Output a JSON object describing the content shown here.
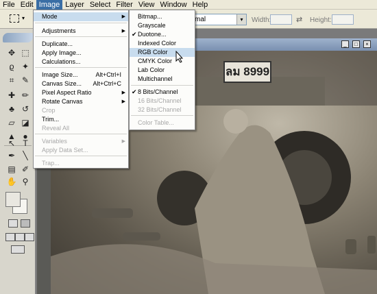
{
  "menubar": {
    "items": [
      "File",
      "Edit",
      "Image",
      "Layer",
      "Select",
      "Filter",
      "View",
      "Window",
      "Help"
    ],
    "active_index": 2
  },
  "options": {
    "style_value": "mal",
    "width_label": "Width:",
    "height_label": "Height:",
    "swap_icon": "swap-icon"
  },
  "image_menu": {
    "items": [
      {
        "label": "Mode",
        "arrow": true,
        "highlighted": true
      },
      {
        "label": "Adjustments",
        "arrow": true
      },
      {
        "label": "Duplicate..."
      },
      {
        "label": "Apply Image..."
      },
      {
        "label": "Calculations..."
      },
      {
        "label": "Image Size...",
        "shortcut": "Alt+Ctrl+I"
      },
      {
        "label": "Canvas Size...",
        "shortcut": "Alt+Ctrl+C"
      },
      {
        "label": "Pixel Aspect Ratio",
        "arrow": true
      },
      {
        "label": "Rotate Canvas",
        "arrow": true
      },
      {
        "label": "Crop",
        "disabled": true
      },
      {
        "label": "Trim..."
      },
      {
        "label": "Reveal All",
        "disabled": true
      },
      {
        "label": "Variables",
        "arrow": true,
        "disabled": true
      },
      {
        "label": "Apply Data Set...",
        "disabled": true
      },
      {
        "label": "Trap...",
        "disabled": true
      }
    ]
  },
  "mode_menu": {
    "items": [
      {
        "label": "Bitmap..."
      },
      {
        "label": "Grayscale"
      },
      {
        "label": "Duotone...",
        "checked": true
      },
      {
        "label": "Indexed Color"
      },
      {
        "label": "RGB Color",
        "highlighted": true
      },
      {
        "label": "CMYK Color"
      },
      {
        "label": "Lab Color"
      },
      {
        "label": "Multichannel"
      },
      {
        "label": "8 Bits/Channel",
        "checked": true
      },
      {
        "label": "16 Bits/Channel",
        "disabled": true
      },
      {
        "label": "32 Bits/Channel",
        "disabled": true
      },
      {
        "label": "Color Table...",
        "disabled": true
      }
    ]
  },
  "photo": {
    "plate_text": "ลม 8999"
  },
  "colors": {
    "menu_highlight": "#c8dcee",
    "menubar_active": "#3a6ea5"
  }
}
